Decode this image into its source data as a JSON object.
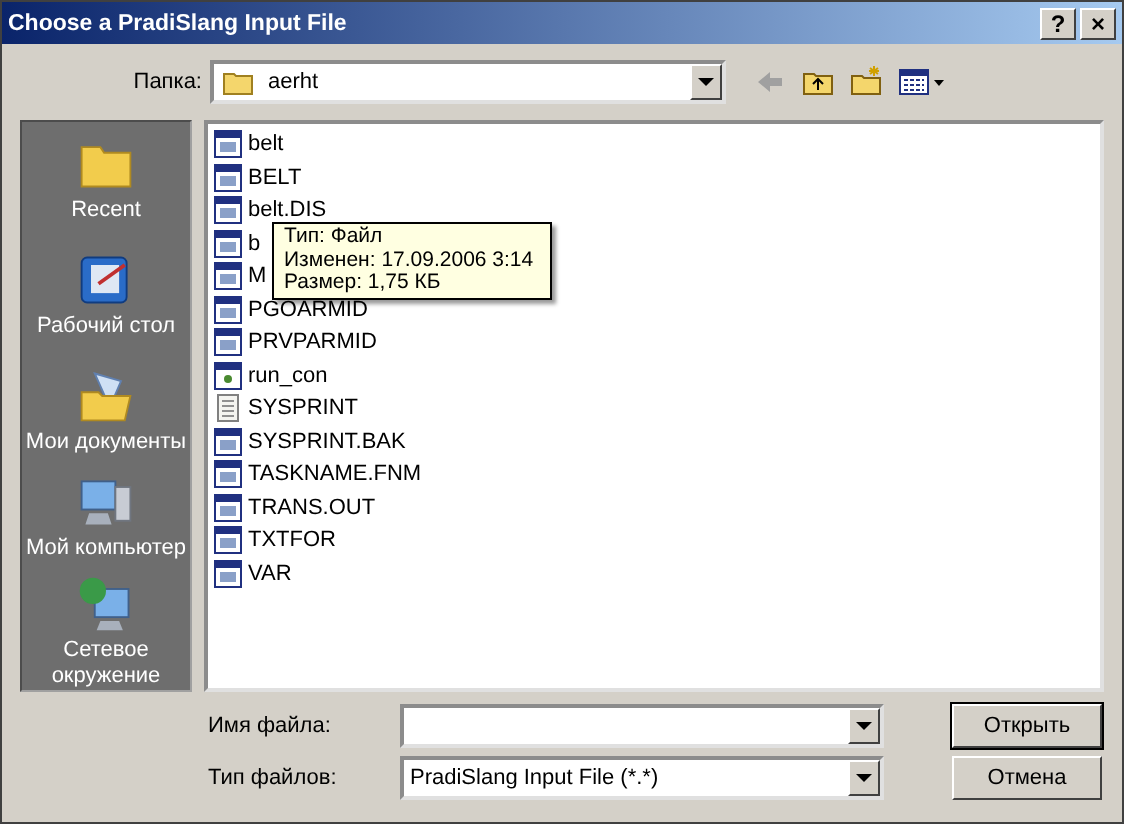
{
  "window": {
    "title": "Choose a PradiSlang Input File",
    "buttons": [
      "?",
      "×"
    ]
  },
  "location": {
    "label": "Папка:",
    "value": "aerht"
  },
  "places": [
    {
      "label": "Recent",
      "kind": "recent"
    },
    {
      "label": "Рабочий стол",
      "kind": "desktop"
    },
    {
      "label": "Мои документы",
      "kind": "documents"
    },
    {
      "label": "Мой компьютер",
      "kind": "computer"
    },
    {
      "label": "Сетевое окружение",
      "kind": "network"
    }
  ],
  "files": [
    {
      "name": "belt",
      "kind": "app"
    },
    {
      "name": "BELT",
      "kind": "app"
    },
    {
      "name": "belt.DIS",
      "kind": "app"
    },
    {
      "name": "b",
      "kind": "app"
    },
    {
      "name": "M",
      "kind": "app"
    },
    {
      "name": "PGOARMID",
      "kind": "app"
    },
    {
      "name": "PRVPARMID",
      "kind": "app"
    },
    {
      "name": "run_con",
      "kind": "exe"
    },
    {
      "name": "SYSPRINT",
      "kind": "text"
    },
    {
      "name": "SYSPRINT.BAK",
      "kind": "app"
    },
    {
      "name": "TASKNAME.FNM",
      "kind": "app"
    },
    {
      "name": "TRANS.OUT",
      "kind": "app"
    },
    {
      "name": "TXTFOR",
      "kind": "app"
    },
    {
      "name": "VAR",
      "kind": "app"
    }
  ],
  "tooltip": [
    "Тип: Файл",
    "Изменен: 17.09.2006 3:14",
    "Размер: 1,75 КБ"
  ],
  "file_name": {
    "label": "Имя файла:"
  },
  "file_type": {
    "label": "Тип файлов:",
    "value": "PradiSlang Input File (*.*)"
  },
  "buttons": [
    "Открыть",
    "Отмена"
  ]
}
